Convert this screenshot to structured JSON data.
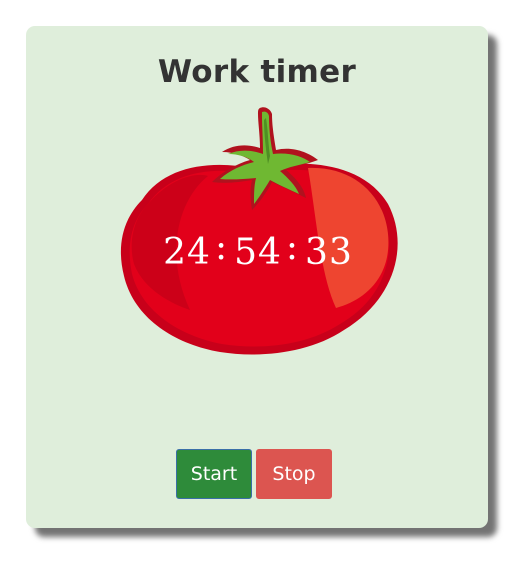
{
  "title": "Work timer",
  "timer": {
    "hours": "24",
    "minutes": "54",
    "seconds": "33",
    "separator": ":"
  },
  "buttons": {
    "start_label": "Start",
    "stop_label": "Stop"
  },
  "colors": {
    "card_background": "#dfeedb",
    "start_button": "#2e8b3a",
    "stop_button": "#dc5550",
    "tomato": "#e2001a"
  },
  "icons": {
    "tomato": "tomato-icon"
  }
}
